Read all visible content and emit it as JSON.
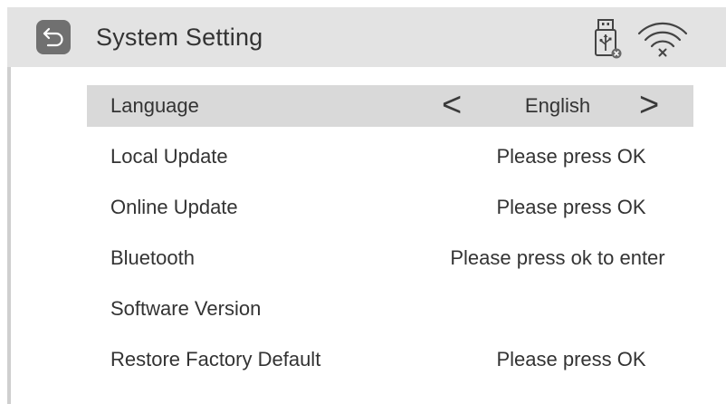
{
  "header": {
    "title": "System Setting",
    "back_icon": "back-arrow-icon",
    "usb_icon": "usb-disconnected-icon",
    "wifi_icon": "wifi-disconnected-icon"
  },
  "menu": {
    "items": [
      {
        "label": "Language",
        "value": "English",
        "selected": true
      },
      {
        "label": "Local Update",
        "value": "Please press OK"
      },
      {
        "label": "Online Update",
        "value": "Please press OK"
      },
      {
        "label": "Bluetooth",
        "value": "Please press ok to enter"
      },
      {
        "label": "Software Version",
        "value": ""
      },
      {
        "label": "Restore Factory Default",
        "value": "Please press OK"
      }
    ],
    "prev_arrow": "<",
    "next_arrow": ">"
  },
  "colors": {
    "header_bg": "#e3e3e3",
    "selected_row_bg": "#d9d9d9",
    "back_button_bg": "#707070",
    "text": "#333333"
  }
}
